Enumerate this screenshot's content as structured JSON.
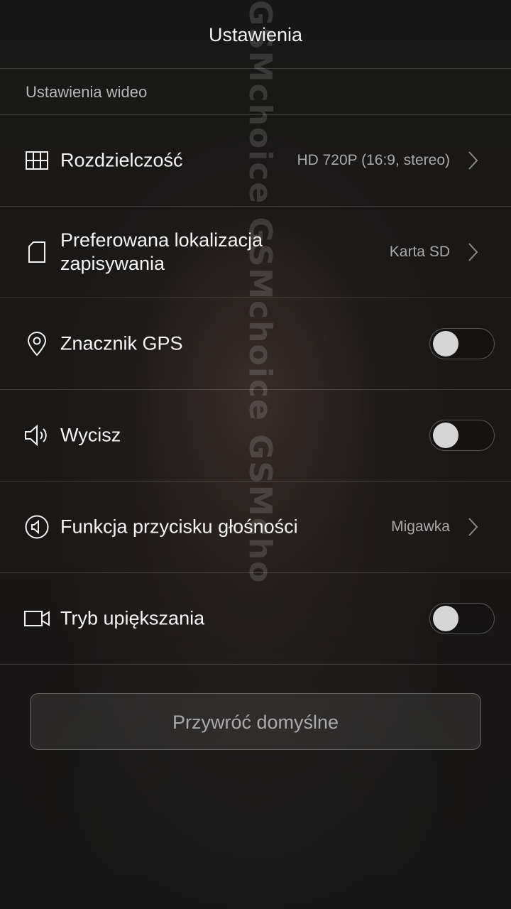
{
  "header": {
    "title": "Ustawienia"
  },
  "section": {
    "title": "Ustawienia wideo"
  },
  "rows": [
    {
      "label": "Rozdzielczość",
      "value": "HD 720P (16:9, stereo)",
      "icon": "grid-icon",
      "control": "chevron"
    },
    {
      "label": "Preferowana lokalizacja zapisywania",
      "value": "Karta SD",
      "icon": "document-icon",
      "control": "chevron"
    },
    {
      "label": "Znacznik GPS",
      "value": "",
      "icon": "location-pin-icon",
      "control": "toggle",
      "state": "off"
    },
    {
      "label": "Wycisz",
      "value": "",
      "icon": "speaker-icon",
      "control": "toggle",
      "state": "off"
    },
    {
      "label": "Funkcja przycisku głośności",
      "value": "Migawka",
      "icon": "volume-button-icon",
      "control": "chevron"
    },
    {
      "label": "Tryb upiększania",
      "value": "",
      "icon": "video-camera-icon",
      "control": "toggle",
      "state": "off"
    }
  ],
  "reset_button": {
    "label": "Przywróć domyślne"
  },
  "watermark": {
    "text": "GSMchoice GSMchoice GSMcho"
  }
}
